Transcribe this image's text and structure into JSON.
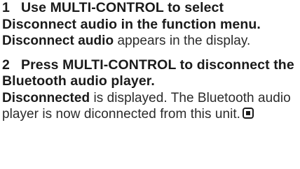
{
  "steps": [
    {
      "number": "1",
      "heading": "Use MULTI-CONTROL to select Disconnect audio in the function menu.",
      "body_bold": "Disconnect audio",
      "body_text": " appears in the display."
    },
    {
      "number": "2",
      "heading": "Press MULTI-CONTROL to disconnect the Bluetooth audio player.",
      "body_bold": "Disconnected",
      "body_text": " is displayed. The Bluetooth audio player is now diconnected from this unit."
    }
  ],
  "end_mark_icon": "end-of-section-square-icon"
}
